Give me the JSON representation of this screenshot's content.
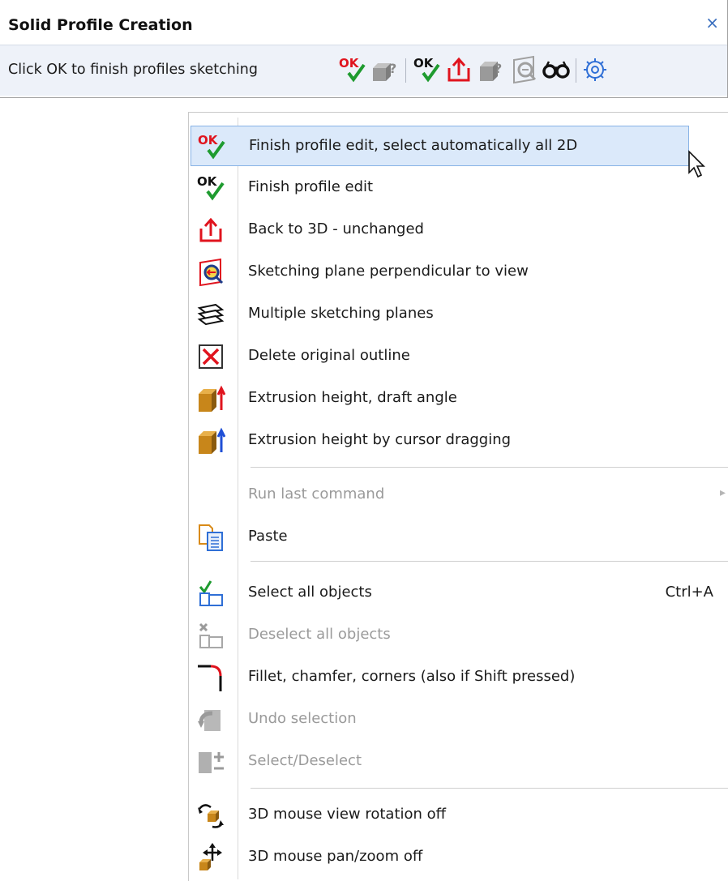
{
  "panel": {
    "title": "Solid Profile Creation",
    "close": "×",
    "hint": "Click OK to finish profiles sketching",
    "toolbar_icons": [
      {
        "name": "ok-auto-select-icon",
        "ok_text": "OK"
      },
      {
        "name": "finish-disabled-icon"
      },
      {
        "name": "ok-finish-icon",
        "ok_text": "OK"
      },
      {
        "name": "back-to-3d-icon"
      },
      {
        "name": "query-gray-icon"
      },
      {
        "name": "sketch-plane-gray-icon"
      },
      {
        "name": "glasses-icon"
      },
      {
        "name": "settings-gear-icon"
      }
    ]
  },
  "menu": {
    "items": [
      {
        "label": "Finish profile edit, select automatically all 2D",
        "icon": "ok-auto-select-icon",
        "hover": true,
        "ok_text": "OK"
      },
      {
        "label": "Finish profile edit",
        "icon": "ok-finish-icon",
        "ok_text": "OK"
      },
      {
        "label": "Back to 3D - unchanged",
        "icon": "back-to-3d-icon"
      },
      {
        "label": "Sketching plane perpendicular to view",
        "icon": "sketch-plane-icon"
      },
      {
        "label": "Multiple sketching planes",
        "icon": "multiple-planes-icon"
      },
      {
        "label": "Delete original outline",
        "icon": "delete-outline-icon"
      },
      {
        "label": "Extrusion height, draft angle",
        "icon": "extrusion-height-icon"
      },
      {
        "label": "Extrusion height by cursor dragging",
        "icon": "extrusion-drag-icon"
      },
      {
        "label": "Run last command",
        "icon": "",
        "disabled": true,
        "submenu": "▸"
      },
      {
        "label": "Paste",
        "icon": "paste-icon"
      },
      {
        "label": "Select all objects",
        "icon": "select-all-icon",
        "shortcut": "Ctrl+A"
      },
      {
        "label": "Deselect all objects",
        "icon": "deselect-all-icon",
        "disabled": true
      },
      {
        "label": "Fillet, chamfer, corners (also if Shift pressed)",
        "icon": "fillet-icon"
      },
      {
        "label": "Undo selection",
        "icon": "undo-selection-icon",
        "disabled": true
      },
      {
        "label": "Select/Deselect",
        "icon": "select-deselect-icon",
        "disabled": true
      },
      {
        "label": "3D mouse view rotation off",
        "icon": "mouse-rotation-icon"
      },
      {
        "label": "3D mouse pan/zoom off",
        "icon": "mouse-pan-zoom-icon"
      }
    ]
  },
  "colors": {
    "hover_bg": "#dbe9fa",
    "hover_border": "#87b3e6",
    "ok_red": "#e0141e",
    "check_green": "#1e9b2f",
    "panel_bg": "#eef2f9"
  }
}
